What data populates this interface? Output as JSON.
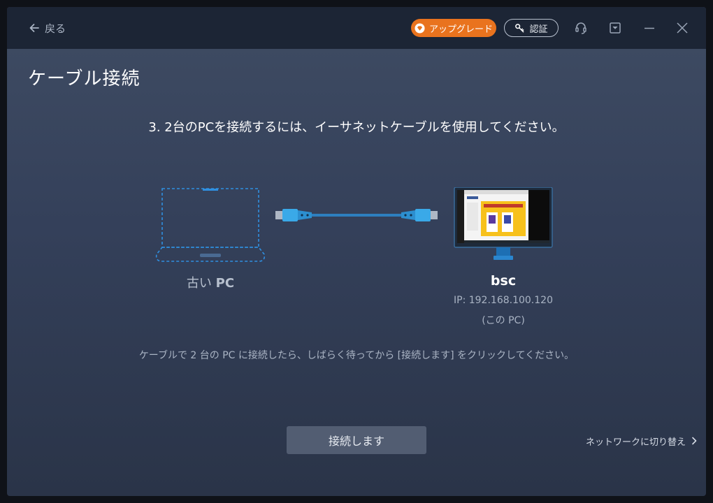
{
  "titlebar": {
    "back_label": "戻る",
    "upgrade_label": "アップグレード",
    "auth_label": "認証",
    "icons": [
      "support-headset-icon",
      "download-icon",
      "minimize-icon",
      "close-icon"
    ]
  },
  "page": {
    "title": "ケーブル接続",
    "step_instruction": "3. 2台のPCを接続するには、イーサネットケーブルを使用してください。"
  },
  "devices": {
    "old_pc": {
      "label_prefix": "古い",
      "label_suffix": "PC"
    },
    "this_pc": {
      "name": "bsc",
      "ip": "IP: 192.168.100.120",
      "note": "(この PC)"
    }
  },
  "hint_text": "ケーブルで 2 台の PC に接続したら、しばらく待ってから [接続します] をクリックしてください。",
  "actions": {
    "connect_label": "接続します",
    "switch_network_label": "ネットワークに切り替え"
  },
  "colors": {
    "accent_orange": "#e9731e",
    "cable_blue": "#3aa9e8",
    "laptop_outline": "#2f8fe0",
    "titlebar_bg": "#1c2535"
  }
}
